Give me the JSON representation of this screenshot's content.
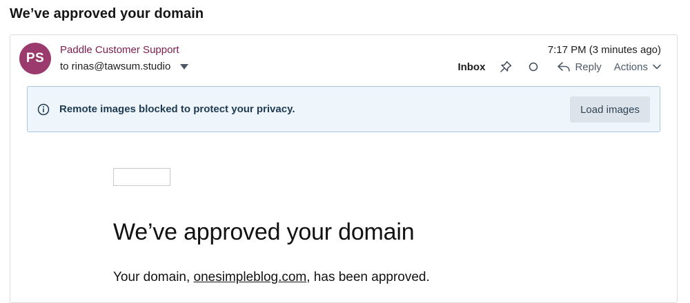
{
  "page": {
    "title": "We’ve approved your domain"
  },
  "message": {
    "avatar_initials": "PS",
    "avatar_color": "#9b3a6c",
    "sender_name": "Paddle Customer Support",
    "sender_color": "#7a1b4d",
    "recipient": "to rinas@tawsum.studio",
    "timestamp": "7:17 PM (3 minutes ago)",
    "toolbar": {
      "folder": "Inbox",
      "pin_icon": "pin-icon",
      "unread_icon": "circle-icon",
      "reply_label": "Reply",
      "reply_icon": "reply-arrow-icon",
      "actions_label": "Actions",
      "actions_icon": "chevron-down-icon"
    }
  },
  "privacy_banner": {
    "icon": "info-icon",
    "text": "Remote images blocked to protect your privacy.",
    "button_label": "Load images",
    "background": "#eef5fb",
    "border_color": "#a8c6df"
  },
  "email_content": {
    "heading": "We’ve approved your domain",
    "body_prefix": "Your domain, ",
    "domain_link": "onesimpleblog.com",
    "body_suffix": ", has been approved."
  }
}
